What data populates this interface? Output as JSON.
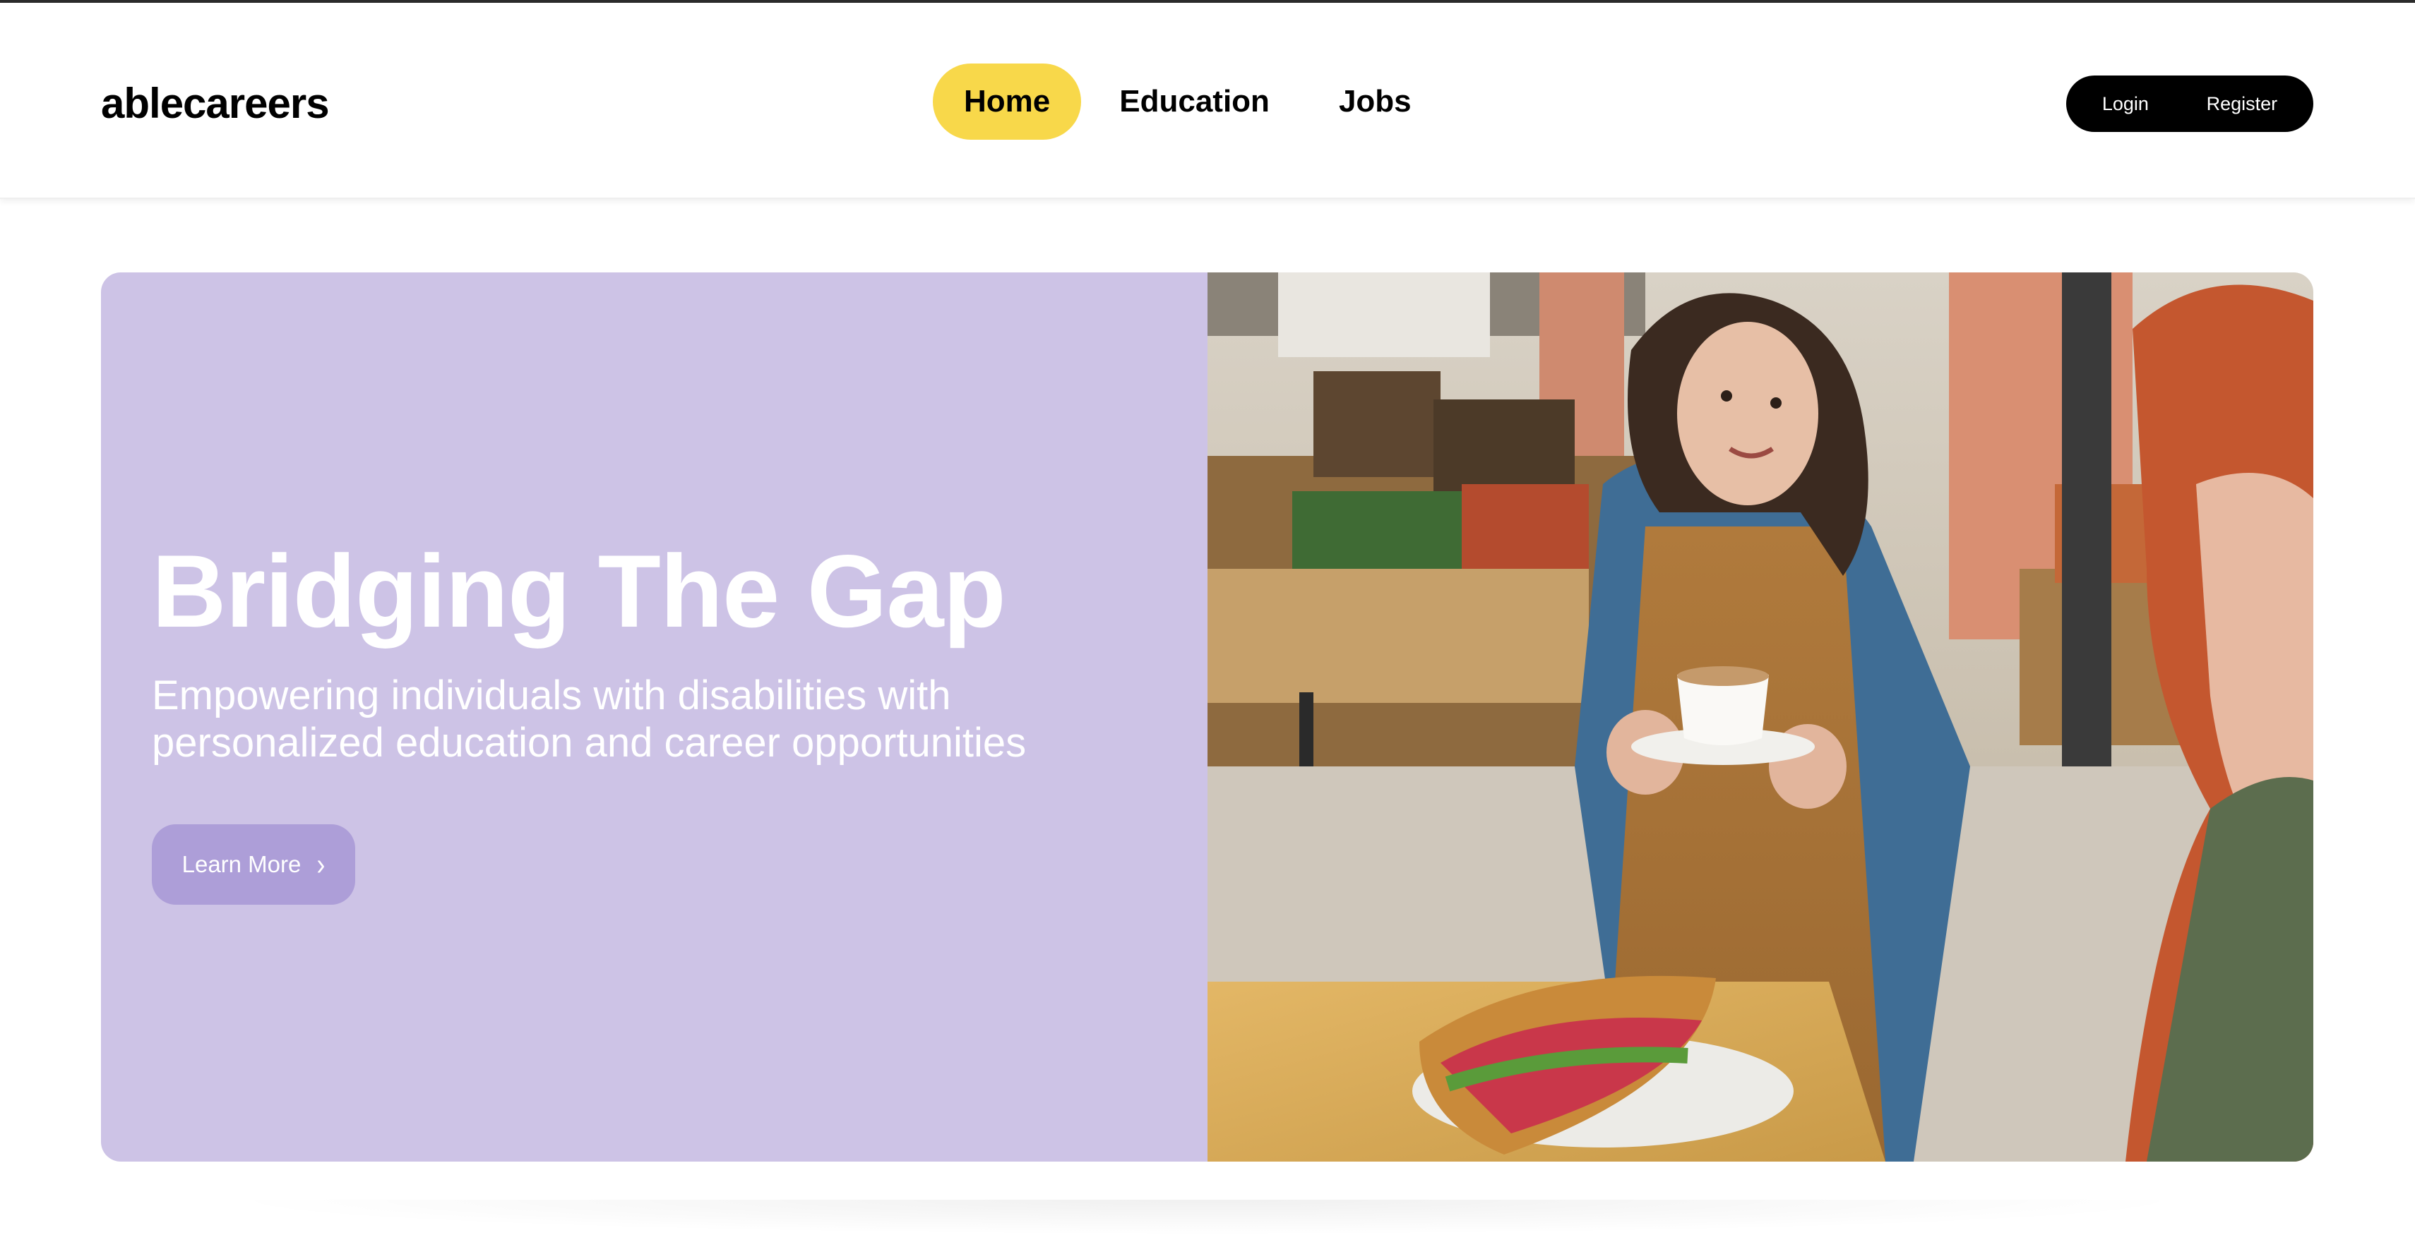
{
  "header": {
    "logo": "ablecareers",
    "nav": [
      {
        "label": "Home",
        "active": true
      },
      {
        "label": "Education",
        "active": false
      },
      {
        "label": "Jobs",
        "active": false
      }
    ],
    "auth": {
      "login_label": "Login",
      "register_label": "Register"
    }
  },
  "hero": {
    "title": "Bridging The Gap",
    "subtitle": "Empowering individuals with disabilities with personalized education and career opportunities",
    "cta_label": "Learn More",
    "cta_icon": "chevron-right-icon",
    "image_subject": "cafe-worker-serving-coffee-photo"
  },
  "colors": {
    "accent_yellow": "#f8d84a",
    "hero_lavender": "#cdc3e6",
    "cta_purple": "#ad9ed8",
    "auth_black": "#000000"
  }
}
